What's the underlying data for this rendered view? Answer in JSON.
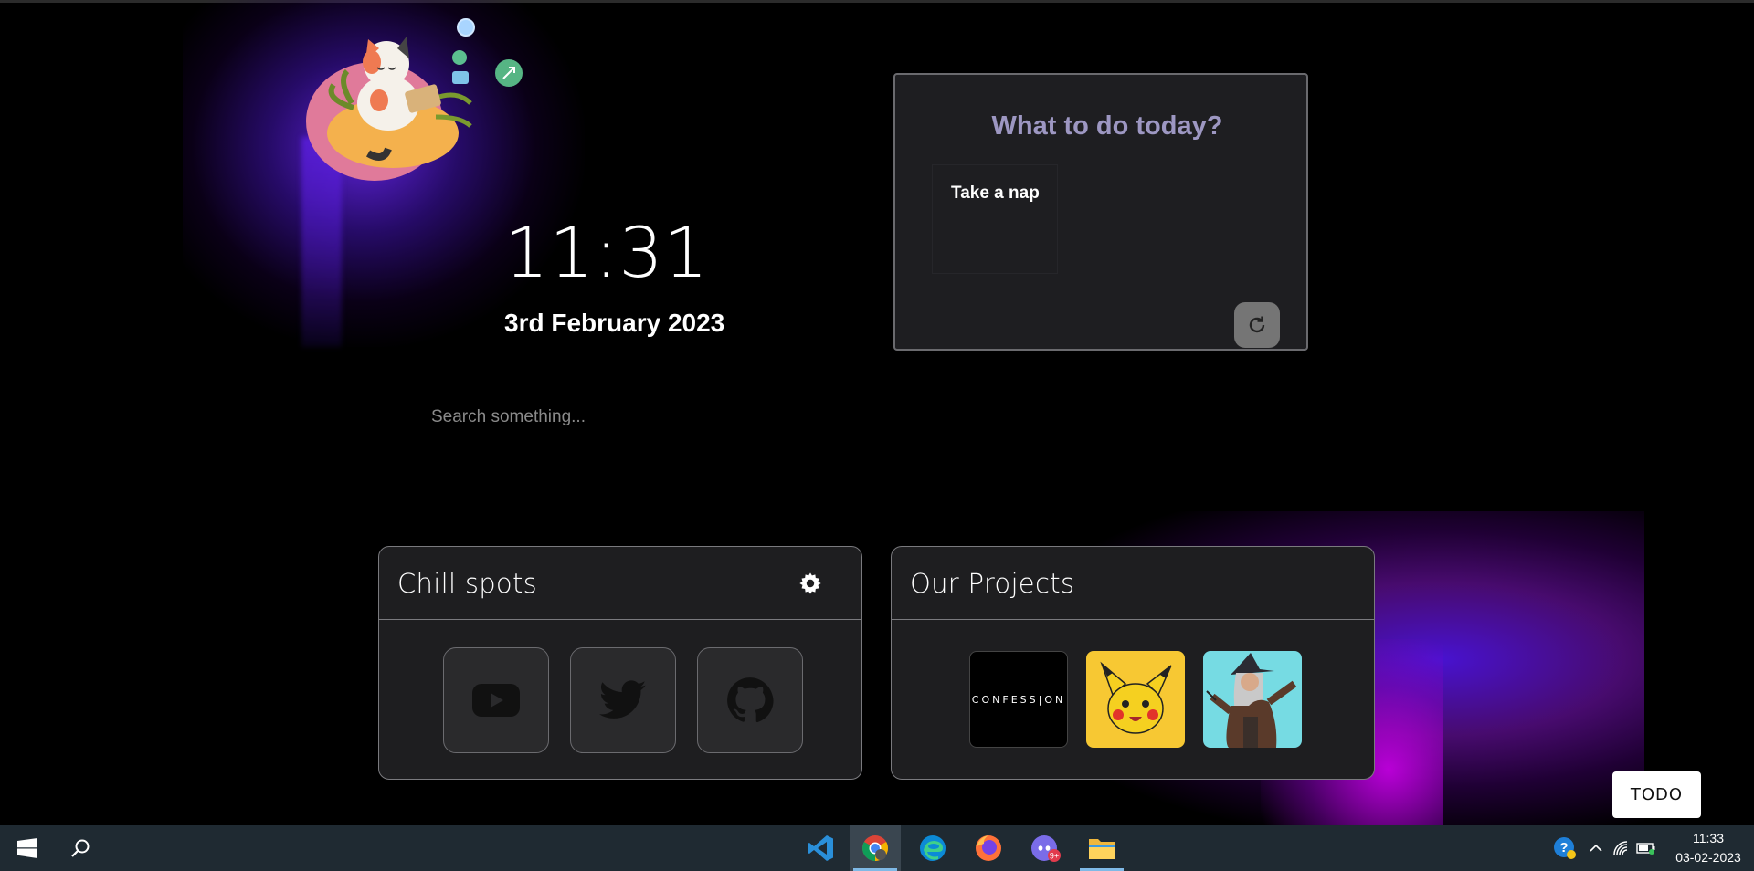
{
  "clock": {
    "time": "11:31",
    "date": "3rd February 2023"
  },
  "search": {
    "placeholder": "Search something..."
  },
  "todo_card": {
    "title": "What to do today?",
    "items": [
      "Take a nap"
    ]
  },
  "chill_spots": {
    "title": "Chill spots",
    "links": [
      {
        "icon": "youtube-icon"
      },
      {
        "icon": "twitter-icon"
      },
      {
        "icon": "github-icon"
      }
    ]
  },
  "projects": {
    "title": "Our Projects",
    "items": [
      {
        "text": "CONFESS|ON"
      },
      {
        "icon": "pikachu-icon"
      },
      {
        "icon": "wizard-icon"
      }
    ]
  },
  "todo_toggle": {
    "label": "TODO"
  },
  "taskbar": {
    "time": "11:33",
    "date": "03-02-2023",
    "notification_badge": "9+"
  },
  "colors": {
    "background": "#000000",
    "card": "#1e1e21",
    "todo_title": "#9d97c2",
    "glow_purple": "#6e28ff",
    "glow_magenta": "#c800e6"
  }
}
